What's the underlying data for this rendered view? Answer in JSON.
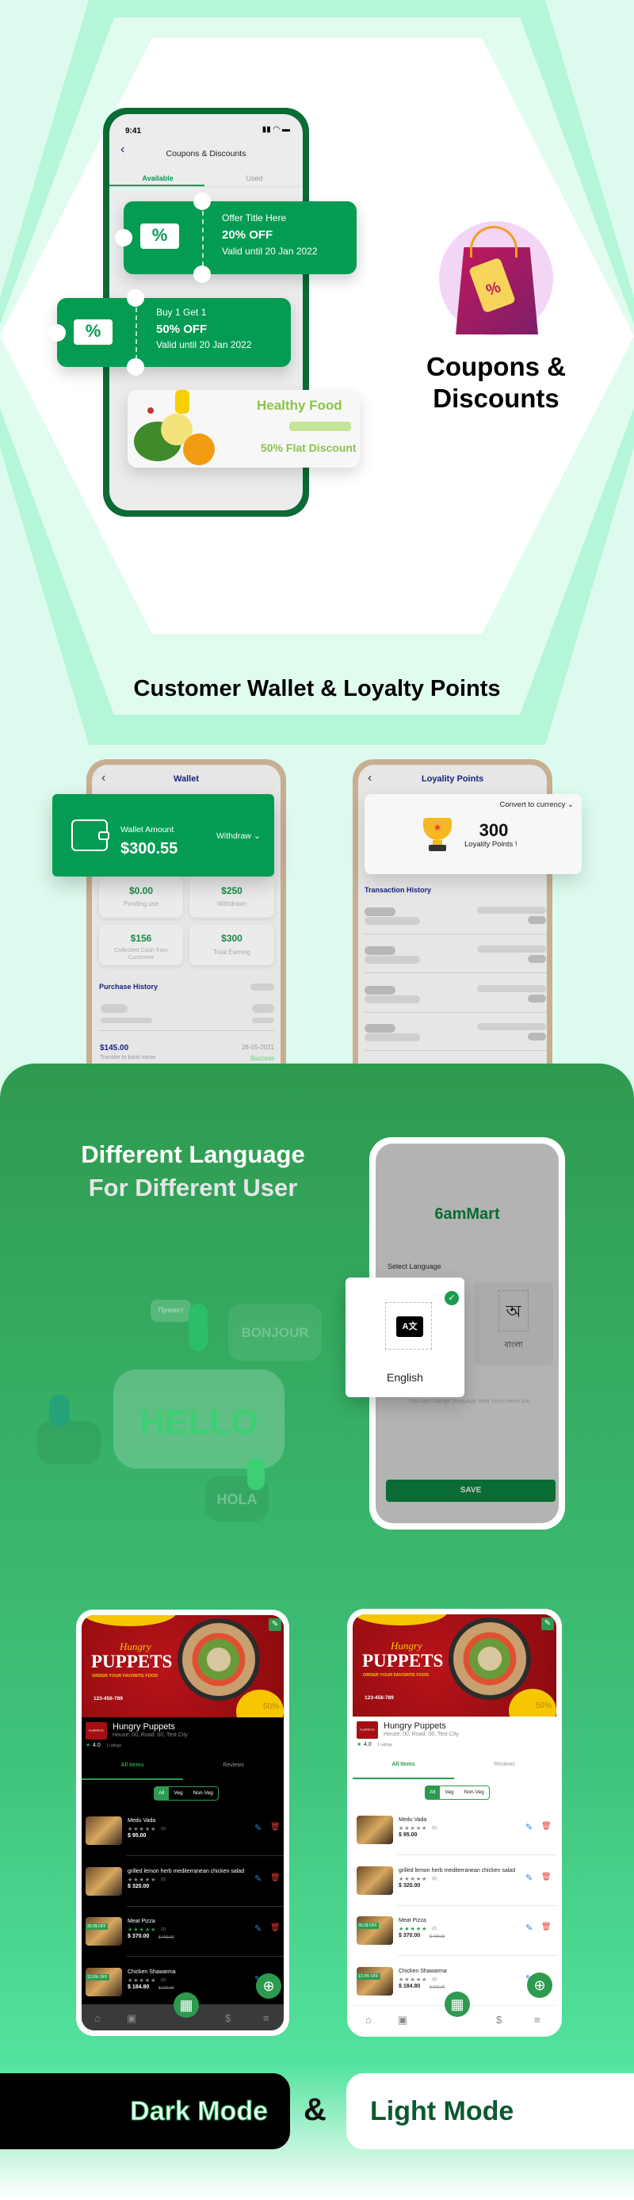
{
  "coupons_section": {
    "status_time": "9:41",
    "screen_title": "Coupons & Discounts",
    "tabs": [
      "Available",
      "Used"
    ],
    "active_tab": "Available",
    "coupons": [
      {
        "title": "Offer Title Here",
        "discount": "20% OFF",
        "validity": "Valid until 20 Jan 2022"
      },
      {
        "title": "Buy 1 Get 1",
        "discount": "50% OFF",
        "validity": "Valid until 20 Jan 2022"
      }
    ],
    "promo_banner": {
      "brand": "Healthy Food",
      "offer": "50% Flat Discount"
    },
    "feature_title_line1": "Coupons &",
    "feature_title_line2": "Discounts"
  },
  "wallet_section": {
    "heading": "Customer Wallet & Loyalty Points",
    "wallet": {
      "screen_title": "Wallet",
      "amount_label": "Wallet Amount",
      "amount": "$300.55",
      "withdraw_label": "Withdraw",
      "stats": [
        {
          "value": "$0.00",
          "label": "Pending use"
        },
        {
          "value": "$250",
          "label": "Withdrawn"
        },
        {
          "value": "$156",
          "label": "Collected Cash from Customer"
        },
        {
          "value": "$300",
          "label": "Total Earning"
        }
      ],
      "history_title": "Purchase History",
      "transaction": {
        "amount": "$145.00",
        "description": "Transfer to bank name",
        "date": "28-05-2021",
        "status": "Success"
      }
    },
    "loyalty": {
      "screen_title": "Loyality Points",
      "convert_label": "Convert to currency",
      "points": "300",
      "points_label": "Loyality Points !",
      "history_title": "Transaction History"
    }
  },
  "language_section": {
    "title_line1": "Different Language",
    "title_line2": "For Different User",
    "illustration_words": [
      "Привет",
      "BONJOUR",
      "HELLO",
      "HOLA"
    ],
    "app_logo": "6amMart",
    "select_label": "Select Language",
    "languages": [
      {
        "name": "English",
        "glyph": "A文",
        "selected": true
      },
      {
        "name": "বাংলা",
        "glyph": "অ",
        "selected": false
      }
    ],
    "hint": "You can change language later from menu bar",
    "save_label": "SAVE"
  },
  "store": {
    "banner_script": "Hungry",
    "banner_title": "PUPPETS",
    "banner_tagline": "ORDER YOUR FAVORITE FOOD",
    "banner_phone": "123-456-789",
    "banner_offer": "50%",
    "name": "Hungry Puppets",
    "address": "House: 00, Road: 00, Test City",
    "rating": "4.0",
    "rating_count": "1 ratings",
    "tabs": [
      "All Items",
      "Reviews"
    ],
    "filters": [
      "All",
      "Veg",
      "Non-Veg"
    ],
    "items": [
      {
        "name": "Medu Vada",
        "reviews": "(0)",
        "price": "$ 95.00",
        "old_price": "",
        "badge": ""
      },
      {
        "name": "grilled lemon herb mediterranean chicken salad",
        "reviews": "(0)",
        "price": "$ 320.00",
        "old_price": "",
        "badge": ""
      },
      {
        "name": "Meat Pizza",
        "reviews": "(2)",
        "price": "$ 370.00",
        "old_price": "$ 400.00",
        "badge": "30.0$ OFF"
      },
      {
        "name": "Chicken Shawarma",
        "reviews": "(0)",
        "price": "$ 184.80",
        "old_price": "$ 210.00",
        "badge": "12.0% OFF"
      }
    ]
  },
  "modes": {
    "dark_label": "Dark Mode",
    "and": "&",
    "light_label": "Light Mode"
  },
  "colors": {
    "brand_green": "#049c53",
    "dark_green": "#0a6b35",
    "section_green": "#2e9a4f",
    "mint": "#52e39e",
    "delete_red": "#e53935",
    "edit_blue": "#1e88e5"
  }
}
